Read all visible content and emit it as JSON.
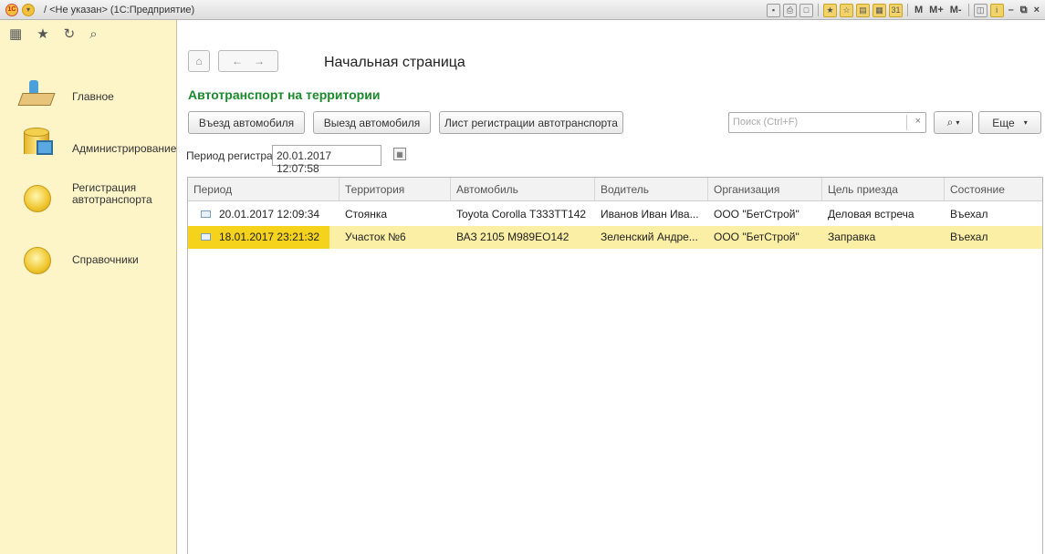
{
  "window": {
    "title": "/ <Не указан> (1С:Предприятие)",
    "toolbar_text": [
      "M",
      "M+",
      "M-"
    ]
  },
  "sidebar": {
    "items": [
      {
        "label": "Главное",
        "icon": "desk-icon"
      },
      {
        "label": "Администрирование",
        "icon": "database-icon"
      },
      {
        "label": "Регистрация автотранспорта",
        "icon": "section-orb-icon"
      },
      {
        "label": "Справочники",
        "icon": "section-orb-icon"
      }
    ]
  },
  "header": {
    "title": "Начальная страница"
  },
  "section": {
    "title": "Автотранспорт на территории"
  },
  "actions": {
    "entry_label": "Въезд автомобиля",
    "exit_label": "Выезд автомобиля",
    "register_label": "Лист регистрации автотранспорта",
    "search_placeholder": "Поиск (Ctrl+F)",
    "more_label": "Еще"
  },
  "filter": {
    "period_label": "Период регистра:",
    "period_value": "20.01.2017 12:07:58"
  },
  "table": {
    "columns": [
      "Период",
      "Территория",
      "Автомобиль",
      "Водитель",
      "Организация",
      "Цель приезда",
      "Состояние"
    ],
    "rows": [
      [
        "20.01.2017 12:09:34",
        "Стоянка",
        "Toyota Corolla Т333ТТ142",
        "Иванов Иван Ива...",
        "ООО \"БетСтрой\"",
        "Деловая встреча",
        "Въехал"
      ],
      [
        "18.01.2017 23:21:32",
        "Участок №6",
        "ВАЗ 2105 М989ЕО142",
        "Зеленский Андре...",
        "ООО \"БетСтрой\"",
        "Заправка",
        "Въехал"
      ]
    ],
    "selected_row": 1
  },
  "colors": {
    "sidebar_bg": "#fdf5c8",
    "section_title": "#1b8a2c",
    "selected_row": "#fbefa5",
    "selected_cell": "#f5d21c"
  }
}
